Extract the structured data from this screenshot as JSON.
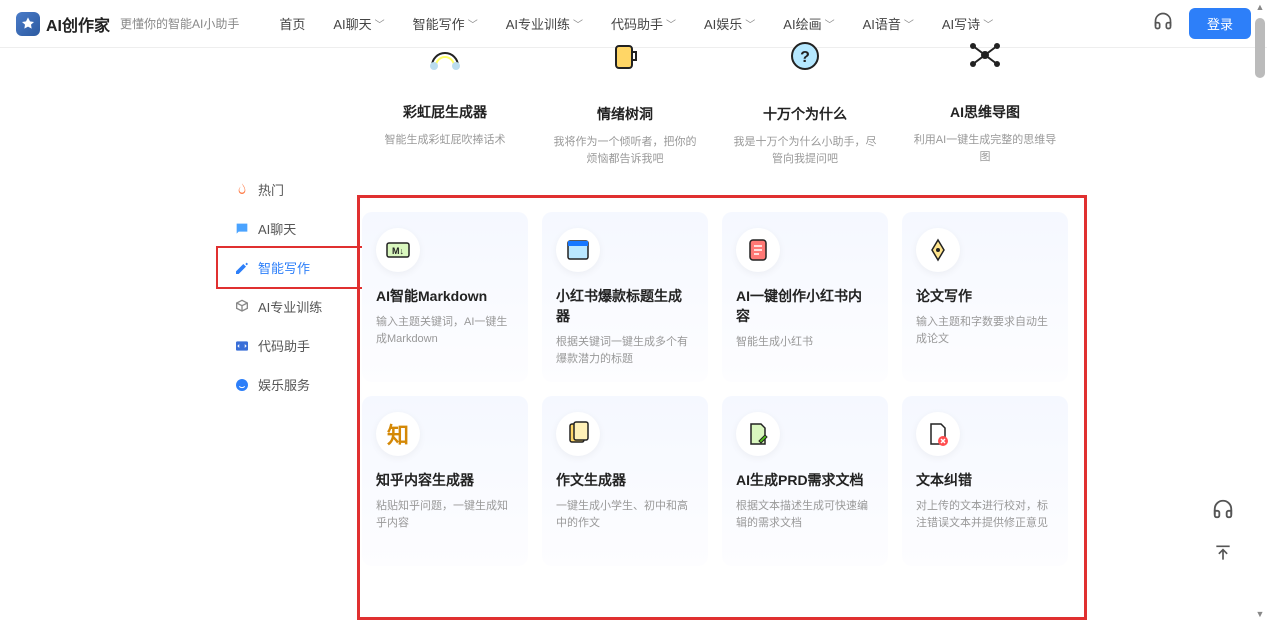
{
  "header": {
    "brand": "AI创作家",
    "subtitle": "更懂你的智能AI小助手",
    "nav": [
      "首页",
      "AI聊天",
      "智能写作",
      "AI专业训练",
      "代码助手",
      "AI娱乐",
      "AI绘画",
      "AI语音",
      "AI写诗"
    ],
    "login": "登录"
  },
  "sidebar": {
    "items": [
      {
        "icon": "fire",
        "label": "热门"
      },
      {
        "icon": "chat",
        "label": "AI聊天"
      },
      {
        "icon": "edit",
        "label": "智能写作"
      },
      {
        "icon": "cube",
        "label": "AI专业训练"
      },
      {
        "icon": "code",
        "label": "代码助手"
      },
      {
        "icon": "smile",
        "label": "娱乐服务"
      }
    ]
  },
  "top_cards": [
    {
      "title": "彩虹屁生成器",
      "desc": "智能生成彩虹屁吹捧话术"
    },
    {
      "title": "情绪树洞",
      "desc": "我将作为一个倾听者，把你的烦恼都告诉我吧"
    },
    {
      "title": "十万个为什么",
      "desc": "我是十万个为什么小助手，尽管向我提问吧"
    },
    {
      "title": "AI思维导图",
      "desc": "利用AI一键生成完整的思维导图"
    }
  ],
  "cards": [
    {
      "title": "AI智能Markdown",
      "desc": "输入主题关键词，AI一键生成Markdown"
    },
    {
      "title": "小红书爆款标题生成器",
      "desc": "根据关键词一键生成多个有爆款潜力的标题"
    },
    {
      "title": "AI一键创作小红书内容",
      "desc": "智能生成小红书"
    },
    {
      "title": "论文写作",
      "desc": "输入主题和字数要求自动生成论文"
    },
    {
      "title": "知乎内容生成器",
      "desc": "粘贴知乎问题，一键生成知乎内容"
    },
    {
      "title": "作文生成器",
      "desc": "一键生成小学生、初中和高中的作文"
    },
    {
      "title": "AI生成PRD需求文档",
      "desc": "根据文本描述生成可快速编辑的需求文档"
    },
    {
      "title": "文本纠错",
      "desc": "对上传的文本进行校对，标注错误文本并提供修正意见"
    }
  ]
}
